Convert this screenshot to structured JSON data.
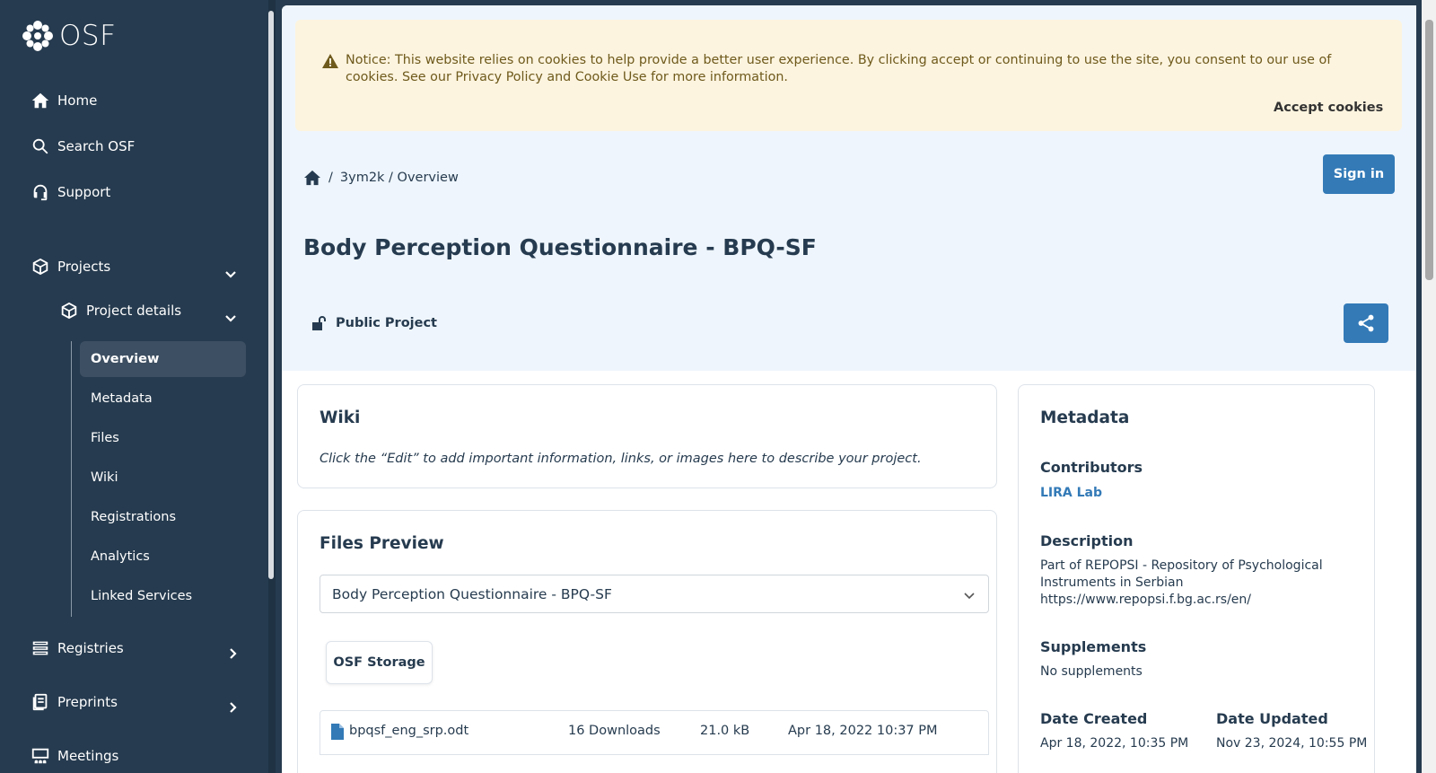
{
  "sidebar": {
    "logo_text": "OSF",
    "nav": {
      "home": "Home",
      "search": "Search OSF",
      "support": "Support",
      "projects": "Projects",
      "project_details": "Project details",
      "registries": "Registries",
      "preprints": "Preprints",
      "meetings": "Meetings"
    },
    "sub_items": [
      "Overview",
      "Metadata",
      "Files",
      "Wiki",
      "Registrations",
      "Analytics",
      "Linked Services"
    ]
  },
  "notice": {
    "text": "Notice: This website relies on cookies to help provide a better user experience. By clicking accept or continuing to use the site, you consent to our use of cookies. See our Privacy Policy and Cookie Use for more information.",
    "accept": "Accept cookies"
  },
  "breadcrumb": {
    "sep": "/",
    "path": "3ym2k / Overview"
  },
  "signin": "Sign in",
  "project": {
    "title": "Body Perception Questionnaire - BPQ-SF",
    "visibility": "Public Project"
  },
  "wiki": {
    "heading": "Wiki",
    "text": "Click the “Edit” to add important information, links, or images here to describe your project."
  },
  "files": {
    "heading": "Files Preview",
    "selected": "Body Perception Questionnaire - BPQ-SF",
    "storage": "OSF Storage",
    "rows": [
      {
        "name": "bpqsf_eng_srp.odt",
        "downloads": "16 Downloads",
        "size": "21.0 kB",
        "date": "Apr 18, 2022 10:37 PM"
      }
    ]
  },
  "metadata": {
    "heading": "Metadata",
    "contributors_label": "Contributors",
    "contributor": "LIRA Lab",
    "description_label": "Description",
    "description_lines": [
      "Part of REPOPSI - Repository of Psychological",
      "Instruments in Serbian",
      "https://www.repopsi.f.bg.ac.rs/en/"
    ],
    "supplements_label": "Supplements",
    "supplements": "No supplements",
    "date_created_label": "Date Created",
    "date_created": "Apr 18, 2022, 10:35 PM",
    "date_updated_label": "Date Updated",
    "date_updated": "Nov 23, 2024, 10:55 PM"
  },
  "colors": {
    "sidebar": "#263b4f",
    "accent": "#337ab7",
    "hero": "#eef5fc",
    "notice": "#fdf4df"
  }
}
